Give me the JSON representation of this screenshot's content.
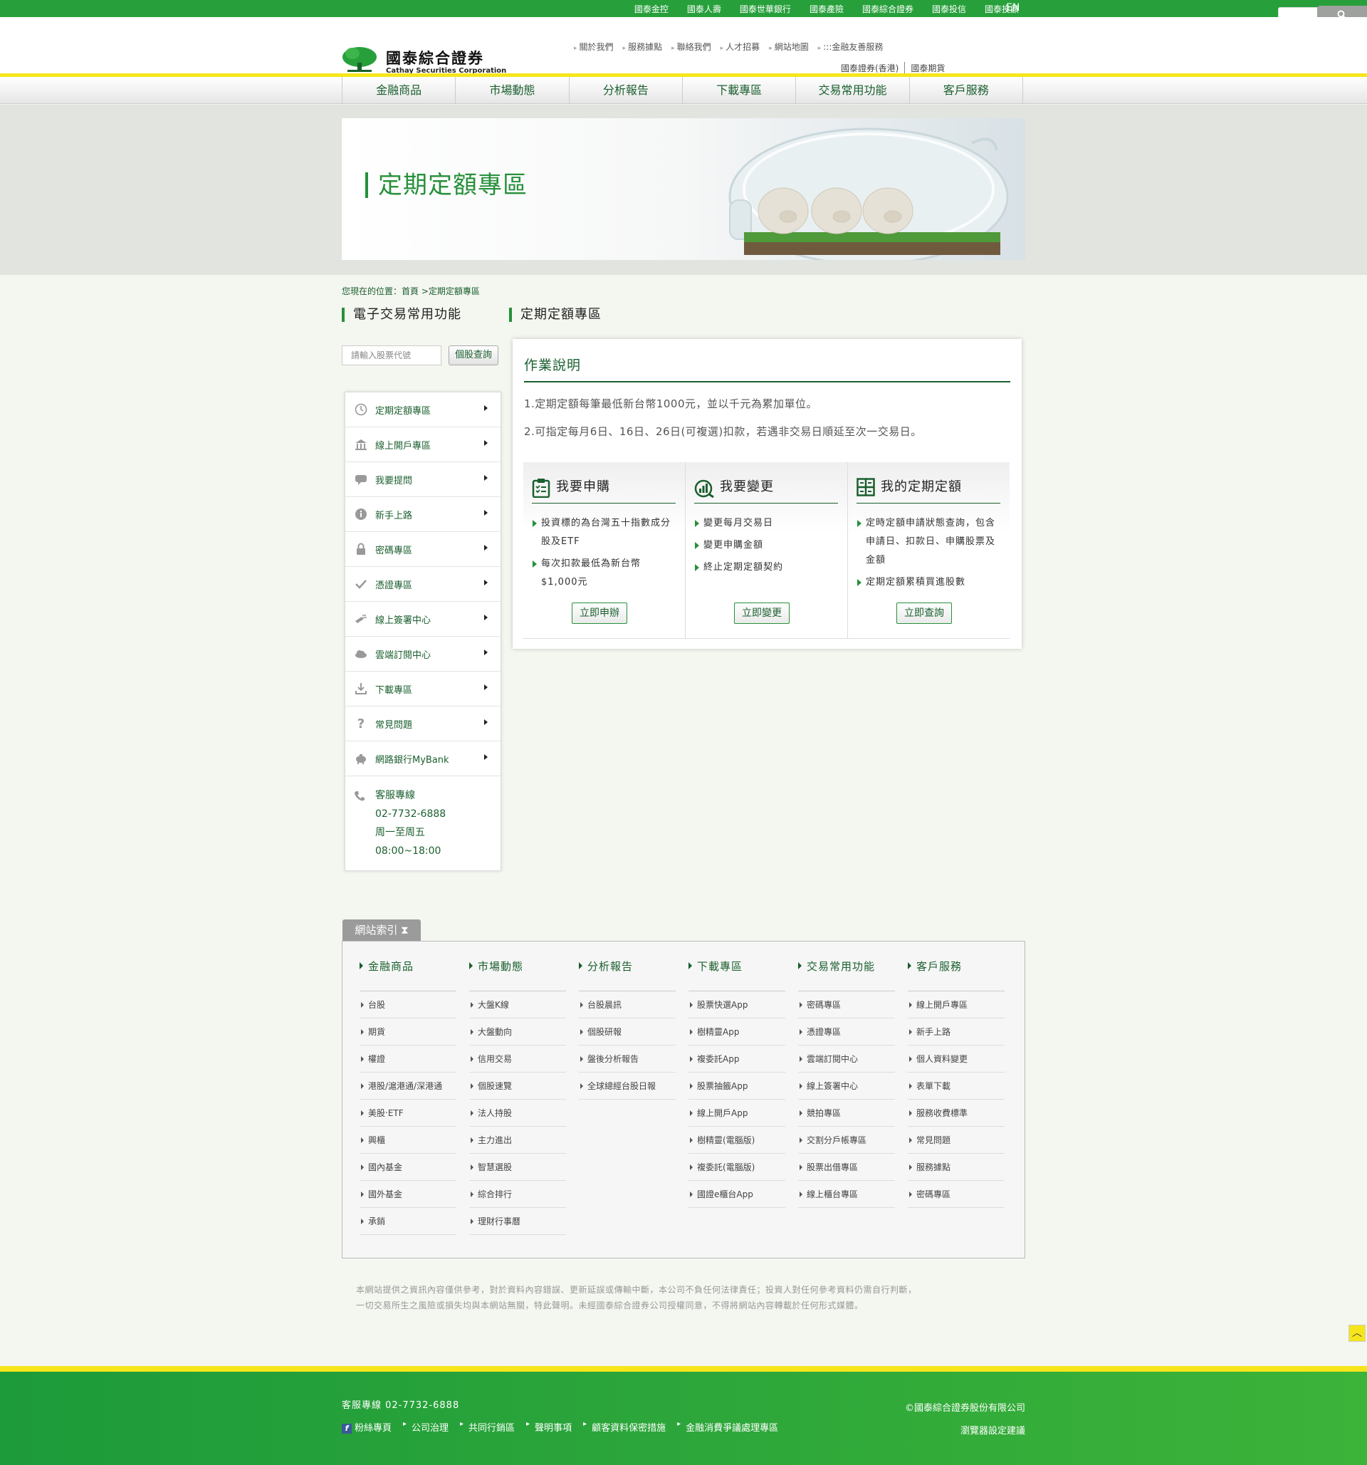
{
  "top_bar": {
    "group_links": [
      "國泰金控",
      "國泰人壽",
      "國泰世華銀行",
      "國泰產險",
      "國泰綜合證券",
      "國泰投信",
      "國泰投顧"
    ],
    "lang": "EN",
    "search_icon": "search-icon"
  },
  "header": {
    "logo_zh": "國泰綜合證券",
    "logo_en": "Cathay Securities Corporation",
    "util_links": [
      "關於我們",
      "服務據點",
      "聯絡我們",
      "人才招募",
      "網站地圖",
      ":::金融友善服務"
    ],
    "sub_links": [
      "國泰證券(香港)",
      "國泰期貨"
    ]
  },
  "nav": [
    "金融商品",
    "市場動態",
    "分析報告",
    "下載專區",
    "交易常用功能",
    "客戶服務"
  ],
  "banner": {
    "title": "定期定額專區"
  },
  "breadcrumb": "您現在的位置：首頁 >定期定額專區",
  "sidebar": {
    "title": "電子交易常用功能",
    "search_placeholder": "請輸入股票代號",
    "search_button": "個股查詢",
    "items": [
      {
        "label": "定期定額專區",
        "icon": "clock-icon"
      },
      {
        "label": "線上開戶專區",
        "icon": "bank-icon"
      },
      {
        "label": "我要提問",
        "icon": "chat-icon"
      },
      {
        "label": "新手上路",
        "icon": "info-icon"
      },
      {
        "label": "密碼專區",
        "icon": "lock-icon"
      },
      {
        "label": "憑證專區",
        "icon": "check-icon"
      },
      {
        "label": "線上簽署中心",
        "icon": "sign-icon"
      },
      {
        "label": "雲端訂閱中心",
        "icon": "cloud-icon"
      },
      {
        "label": "下載專區",
        "icon": "download-icon"
      },
      {
        "label": "常見問題",
        "icon": "question-icon"
      },
      {
        "label": "網路銀行MyBank",
        "icon": "piggy-icon"
      }
    ],
    "contact": {
      "title": "客服專線",
      "phone": "02-7732-6888",
      "days": "周一至周五",
      "hours": "08:00~18:00"
    }
  },
  "main": {
    "title": "定期定額專區",
    "panel_title": "作業說明",
    "notes": [
      "1.定期定額每筆最低新台幣1000元，並以千元為累加單位。",
      "2.可指定每月6日、16日、26日(可複選)扣款，若遇非交易日順延至次一交易日。"
    ],
    "cards": [
      {
        "title": "我要申購",
        "items": [
          "投資標的為台灣五十指數成分股及ETF",
          "每次扣款最低為新台幣$1,000元"
        ],
        "button": "立即申辦"
      },
      {
        "title": "我要變更",
        "items": [
          "變更每月交易日",
          "變更申購金額",
          "終止定期定額契約"
        ],
        "button": "立即變更"
      },
      {
        "title": "我的定期定額",
        "items": [
          "定時定額申請狀態查詢，包含申請日、扣款日、申購股票及金額",
          "定期定額累積買進股數"
        ],
        "button": "立即查詢"
      }
    ]
  },
  "site_index": {
    "tab": "網站索引",
    "columns": [
      {
        "title": "金融商品",
        "links": [
          "台股",
          "期貨",
          "權證",
          "港股/滬港通/深港通",
          "美股‧ETF",
          "興櫃",
          "國內基金",
          "國外基金",
          "承銷"
        ]
      },
      {
        "title": "市場動態",
        "links": [
          "大盤K線",
          "大盤動向",
          "信用交易",
          "個股速覽",
          "法人持股",
          "主力進出",
          "智慧選股",
          "綜合排行",
          "理財行事曆"
        ]
      },
      {
        "title": "分析報告",
        "links": [
          "台股晨訊",
          "個股研報",
          "盤後分析報告",
          "全球總經台股日報"
        ]
      },
      {
        "title": "下載專區",
        "links": [
          "股票快選App",
          "樹精靈App",
          "複委託App",
          "股票抽籤App",
          "線上開戶App",
          "樹精靈(電腦版)",
          "複委託(電腦版)",
          "國證e櫃台App"
        ]
      },
      {
        "title": "交易常用功能",
        "links": [
          "密碼專區",
          "憑證專區",
          "雲端訂閱中心",
          "線上簽署中心",
          "競拍專區",
          "交割分戶帳專區",
          "股票出借專區",
          "線上櫃台專區"
        ]
      },
      {
        "title": "客戶服務",
        "links": [
          "線上開戶專區",
          "新手上路",
          "個人資料變更",
          "表單下載",
          "服務收費標準",
          "常見問題",
          "服務據點",
          "密碼專區"
        ]
      }
    ]
  },
  "disclaimer": [
    "本網站提供之資訊內容僅供參考，對於資料內容錯誤、更新延誤或傳輸中斷，本公司不負任何法律責任；投資人對任何參考資料仍需自行判斷，",
    "一切交易所生之風險或損失均與本網站無關，特此聲明。未經國泰綜合證券公司授權同意，不得將網站內容轉載於任何形式媒體。"
  ],
  "footer": {
    "hotline": "客服專線 02-7732-6888",
    "links": [
      "粉絲專頁",
      "公司治理",
      "共同行銷區",
      "聲明事項",
      "顧客資料保密措施",
      "金融消費爭議處理專區"
    ],
    "copyright": "©國泰綜合證券股份有限公司",
    "browser": "瀏覽器設定建議"
  },
  "colors": {
    "brand_green": "#27a03b",
    "dark_green": "#1a5f2e",
    "accent_yellow": "#f6e51b"
  }
}
